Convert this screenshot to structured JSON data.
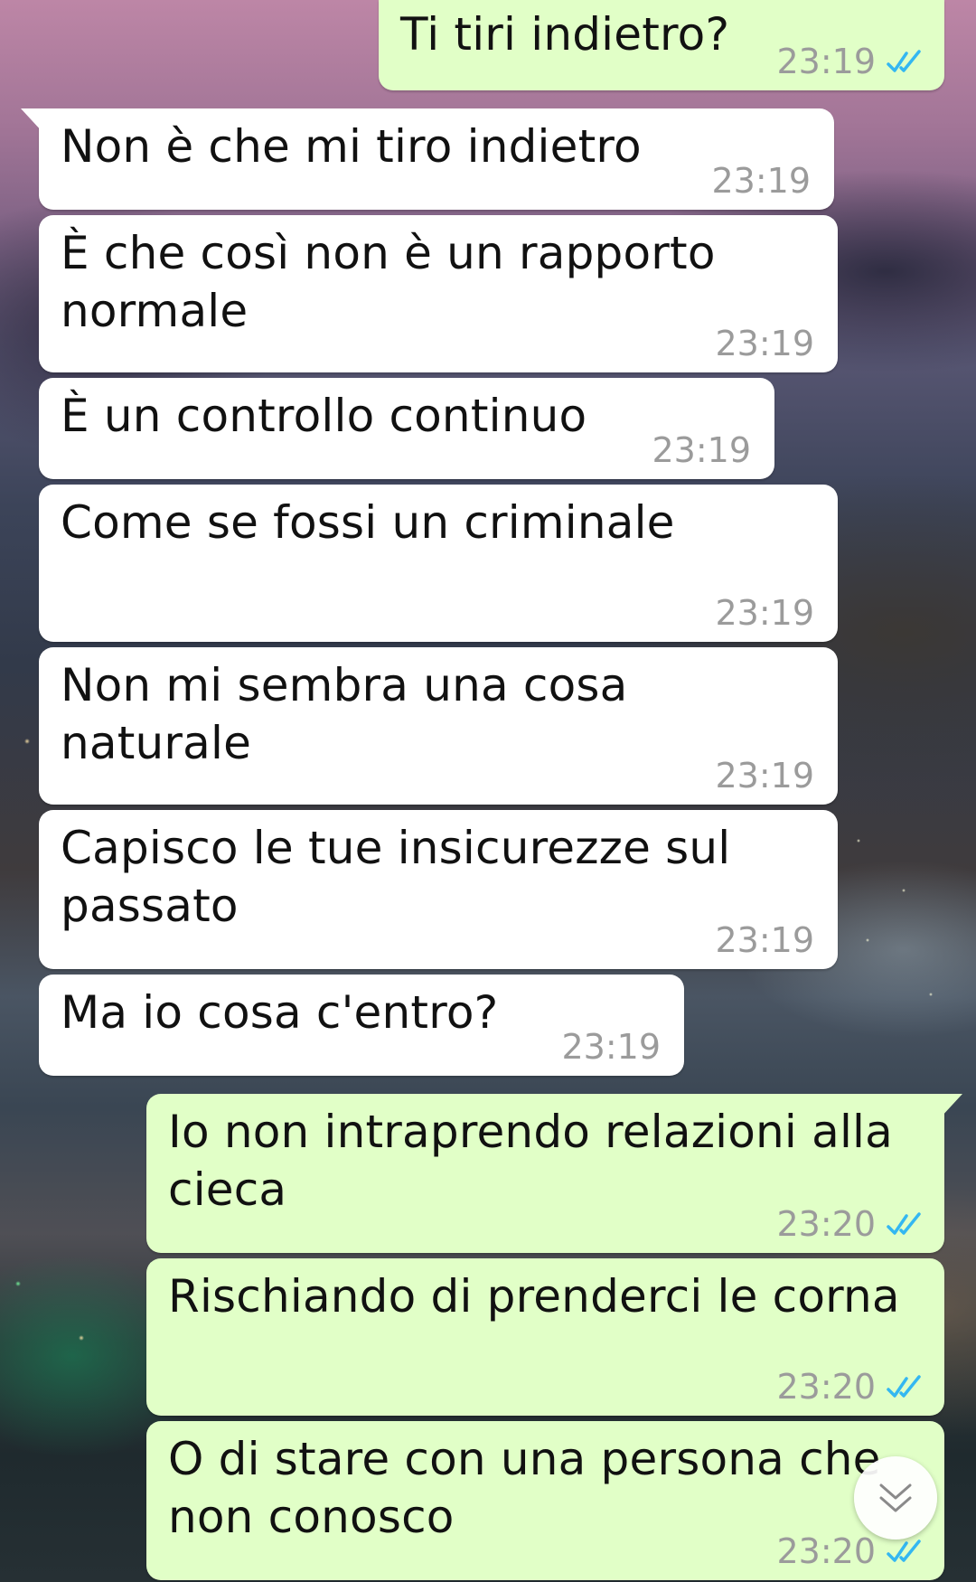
{
  "messages": [
    {
      "dir": "out",
      "text": "Ti tiri indietro?",
      "time": "23:19",
      "status": "read"
    },
    {
      "dir": "in",
      "text": "Non è che mi tiro indietro",
      "time": "23:19"
    },
    {
      "dir": "in",
      "text": "È che così non è un rapporto\nnormale",
      "time": "23:19"
    },
    {
      "dir": "in",
      "text": "È un controllo continuo",
      "time": "23:19"
    },
    {
      "dir": "in",
      "text": "Come se fossi un criminale",
      "time": "23:19"
    },
    {
      "dir": "in",
      "text": "Non mi sembra una cosa\nnaturale",
      "time": "23:19"
    },
    {
      "dir": "in",
      "text": "Capisco le tue insicurezze sul\npassato",
      "time": "23:19"
    },
    {
      "dir": "in",
      "text": "Ma io cosa c'entro?",
      "time": "23:19"
    },
    {
      "dir": "out",
      "text": "Io non intraprendo relazioni alla\ncieca",
      "time": "23:20",
      "status": "read"
    },
    {
      "dir": "out",
      "text": "Rischiando di prenderci le corna",
      "time": "23:20",
      "status": "read"
    },
    {
      "dir": "out",
      "text": "O di stare con una persona che\nnon conosco",
      "time": "23:20",
      "status": "read"
    }
  ],
  "colors": {
    "incoming_bubble": "#ffffff",
    "outgoing_bubble": "#e1ffc7",
    "read_ticks": "#34b7f1",
    "time_text": "#9b9b9b"
  },
  "scroll_button_icon": "double-chevron-down-icon"
}
